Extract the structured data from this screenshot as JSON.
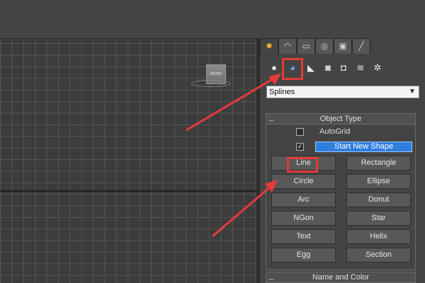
{
  "command_panel": {
    "tabs": [
      {
        "icon": "create-icon",
        "glyph": "✸",
        "active": true
      },
      {
        "icon": "modify-icon",
        "glyph": "◠",
        "active": false
      },
      {
        "icon": "hierarchy-icon",
        "glyph": "▭",
        "active": false
      },
      {
        "icon": "motion-icon",
        "glyph": "◎",
        "active": false
      },
      {
        "icon": "display-icon",
        "glyph": "▣",
        "active": false
      },
      {
        "icon": "utilities-icon",
        "glyph": "╱",
        "active": false
      }
    ],
    "categories": [
      {
        "icon": "geometry-icon",
        "glyph": "●",
        "selected": false
      },
      {
        "icon": "shapes-icon",
        "glyph": "◕",
        "selected": true
      },
      {
        "icon": "lights-icon",
        "glyph": "◣",
        "selected": false
      },
      {
        "icon": "cameras-icon",
        "glyph": "◙",
        "selected": false
      },
      {
        "icon": "helpers-icon",
        "glyph": "◘",
        "selected": false
      },
      {
        "icon": "space-warps-icon",
        "glyph": "≋",
        "selected": false
      },
      {
        "icon": "systems-icon",
        "glyph": "✲",
        "selected": false
      }
    ],
    "dropdown": {
      "value": "Splines"
    },
    "object_type": {
      "title": "Object Type",
      "autogrid": {
        "label": "AutoGrid",
        "checked": false
      },
      "start_new_shape": {
        "label": "Start New Shape",
        "checked": true
      },
      "buttons": [
        "Line",
        "Rectangle",
        "Circle",
        "Ellipse",
        "Arc",
        "Donut",
        "NGon",
        "Star",
        "Text",
        "Helix",
        "Egg",
        "Section"
      ]
    },
    "name_and_color": {
      "title": "Name and Color"
    }
  },
  "viewport": {
    "viewcube_label": "FRONT"
  },
  "colors": {
    "highlight": "#e53a3a",
    "accent_blue": "#2f7fe0"
  }
}
